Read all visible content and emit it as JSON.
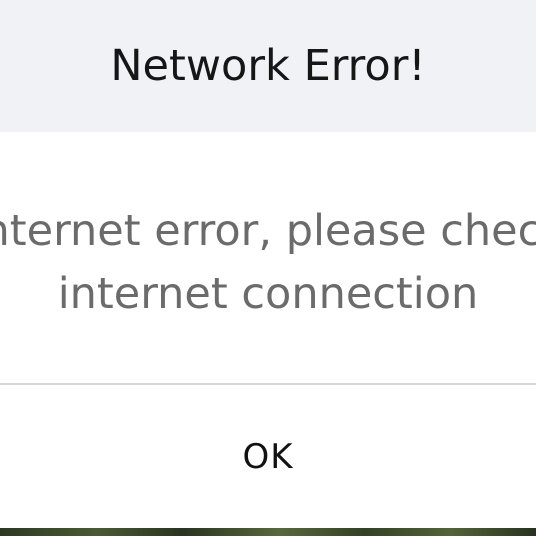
{
  "dialog": {
    "title": "Network Error!",
    "message_line_1": "Internet error, please check",
    "message_line_2": "internet connection",
    "ok_label": "OK"
  },
  "colors": {
    "header_background": "#f1f2f6",
    "title_text": "#161616",
    "message_text": "#6b6b6b",
    "divider": "#d7d7d7"
  }
}
